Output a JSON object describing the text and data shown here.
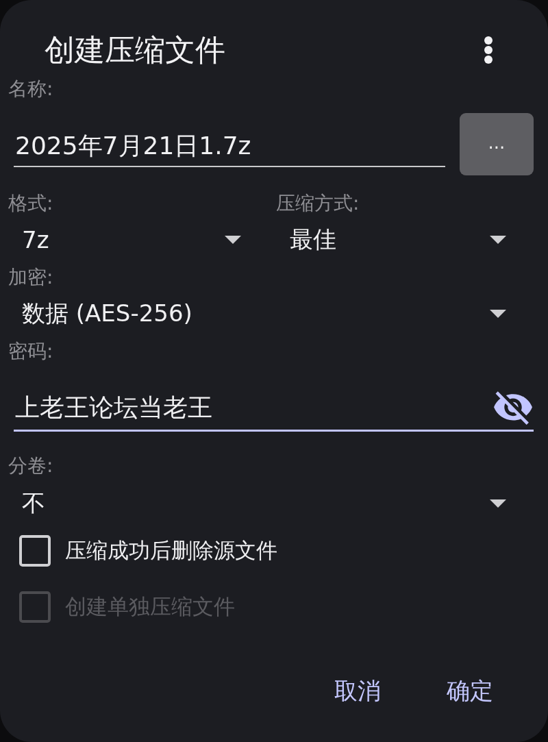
{
  "dialog": {
    "title": "创建压缩文件"
  },
  "name": {
    "label": "名称:",
    "value": "2025年7月21日1.7z",
    "focused": false,
    "browse_button": "..."
  },
  "options_row": [
    {
      "label": "格式:",
      "value": "7z"
    },
    {
      "label": "压缩方式:",
      "value": "最佳"
    }
  ],
  "encryption": {
    "label": "加密:",
    "value": "数据 (AES-256)"
  },
  "password": {
    "label": "密码:",
    "value": "上老王论坛当老王",
    "focused": true
  },
  "split_volumes": {
    "label": "分卷:",
    "value": "不"
  },
  "checkboxes": [
    {
      "label": "压缩成功后删除源文件",
      "checked": false,
      "disabled": false
    },
    {
      "label": "创建单独压缩文件",
      "checked": false,
      "disabled": true
    }
  ],
  "buttons": [
    "取消",
    "确定"
  ]
}
